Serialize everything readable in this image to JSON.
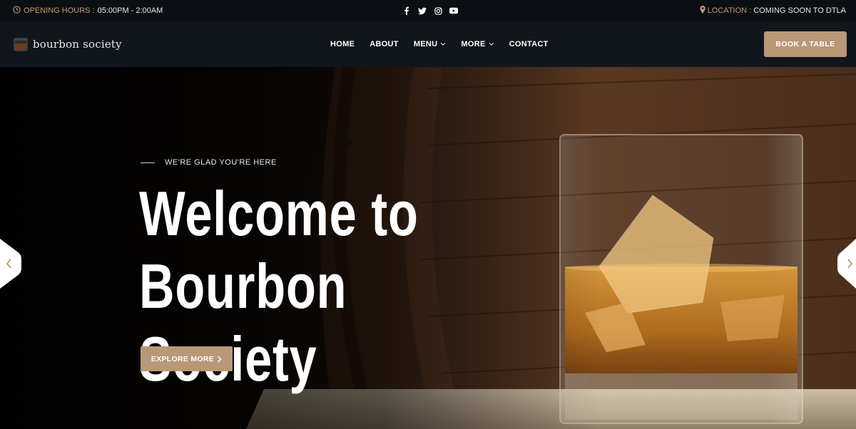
{
  "topbar": {
    "hours_label": "OPENING HOURS :",
    "hours_value": "05:00PM - 2:00AM",
    "location_label": "LOCATION :",
    "location_value": "COMING SOON TO DTLA",
    "social_icons": [
      "facebook-icon",
      "twitter-icon",
      "instagram-icon",
      "youtube-icon"
    ]
  },
  "navbar": {
    "brand": "bourbon society",
    "items": [
      {
        "label": "HOME",
        "dropdown": false
      },
      {
        "label": "ABOUT",
        "dropdown": false
      },
      {
        "label": "MENU",
        "dropdown": true
      },
      {
        "label": "MORE",
        "dropdown": true
      },
      {
        "label": "CONTACT",
        "dropdown": false
      }
    ],
    "cta": "BOOK A TABLE"
  },
  "hero": {
    "tagline": "WE'RE GLAD YOU'RE HERE",
    "headline_line1": "Welcome to",
    "headline_line2": "Bourbon Society",
    "button": "EXPLORE MORE"
  },
  "colors": {
    "accent": "#b99878",
    "top_bg": "#0b0f14",
    "nav_bg": "#11161c",
    "muted_gold": "#c49a6c"
  }
}
